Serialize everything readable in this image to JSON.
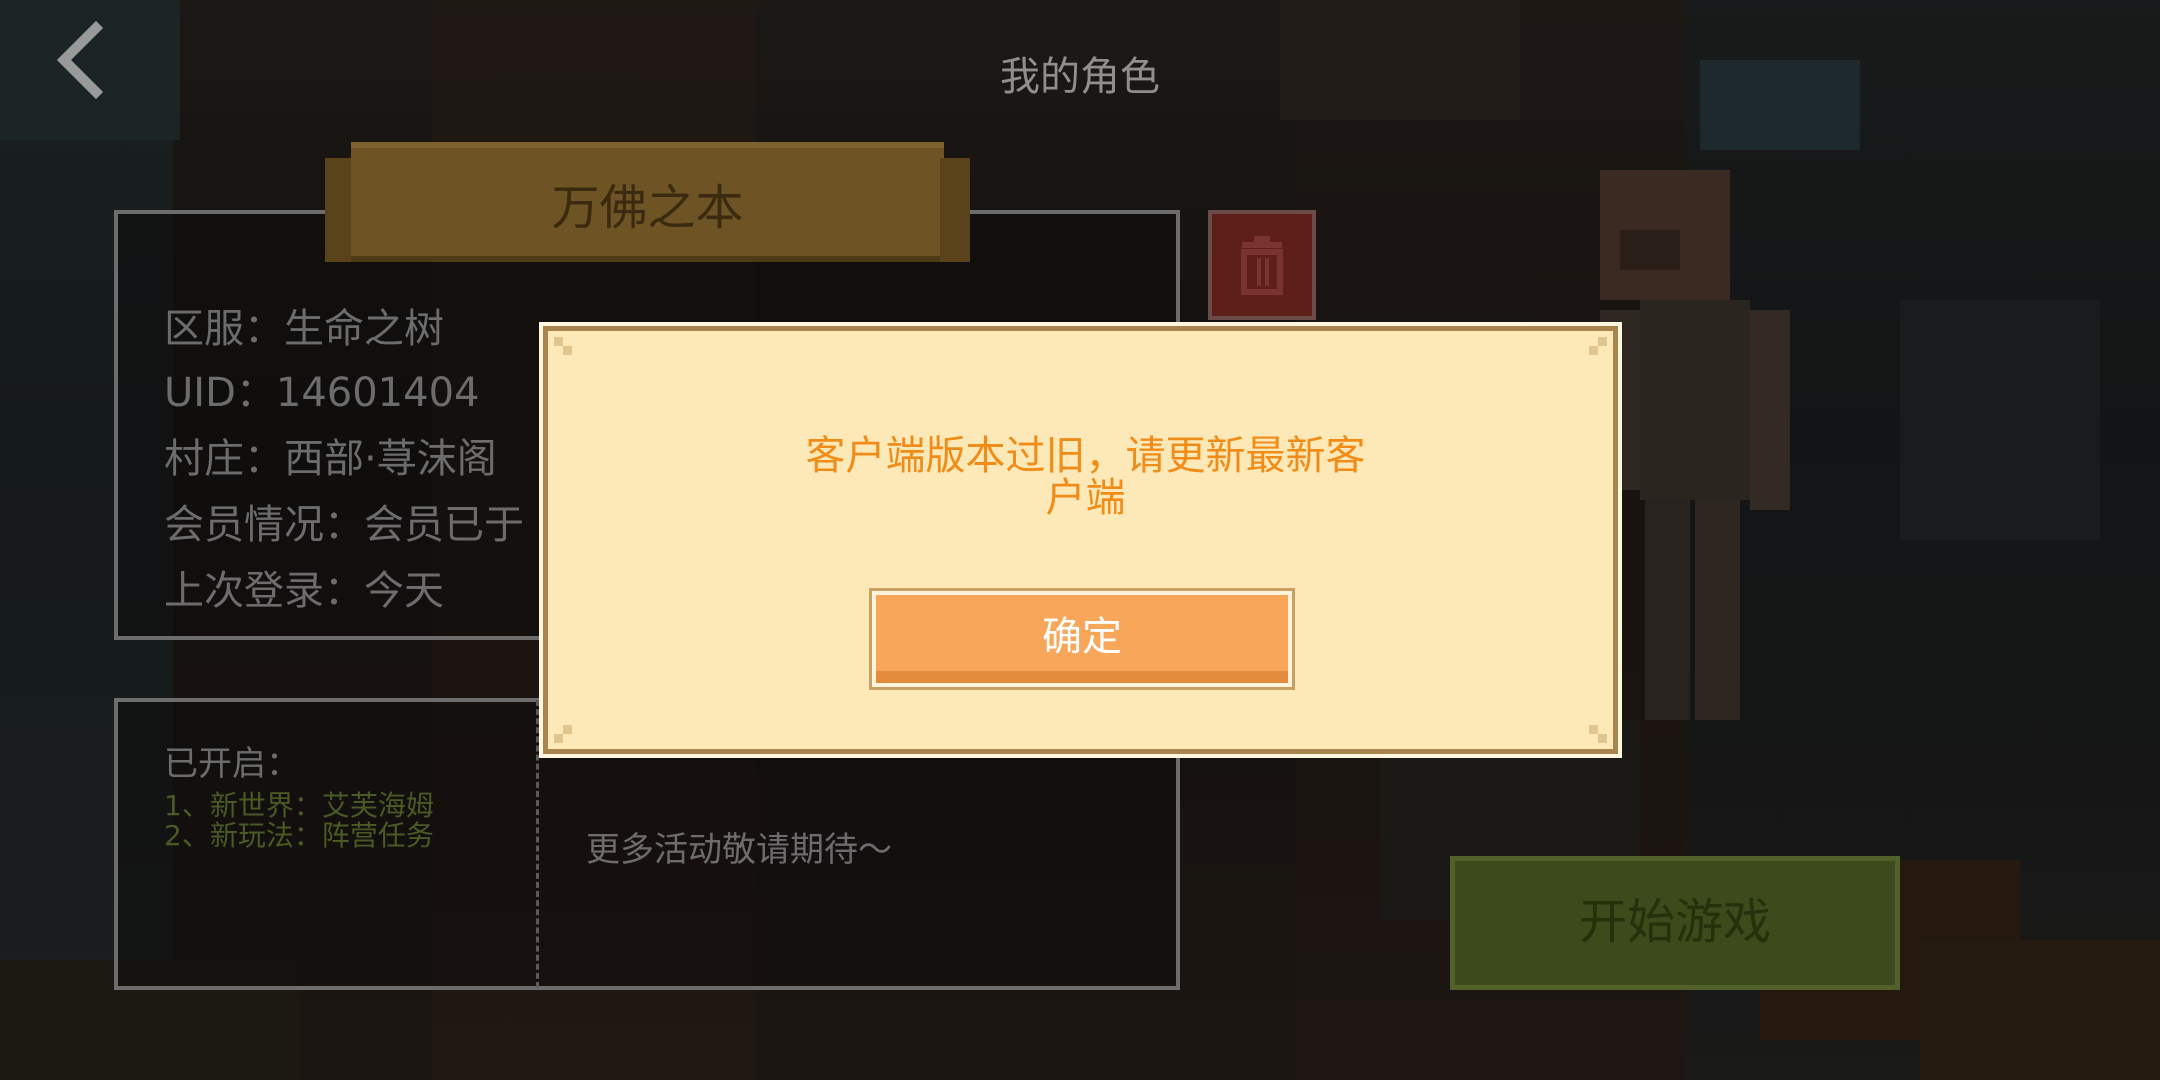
{
  "header": {
    "back_icon": "chevron-left-icon",
    "title": "我的角色"
  },
  "character": {
    "name": "万佛之本",
    "info": [
      "区服：生命之树",
      "UID：14601404",
      "村庄：西部·荨沫阁",
      "会员情况：会员已于",
      "上次登录：今天"
    ],
    "delete_icon": "trash-icon"
  },
  "events": {
    "opened_title": "已开启：",
    "opened_items": [
      "1、新世界：艾芙海姆",
      "2、新玩法：阵营任务"
    ],
    "more_text": "更多活动敬请期待～"
  },
  "start_button": {
    "label": "开始游戏",
    "color": "#3d4a1c"
  },
  "dialog": {
    "message_line1": "客户端版本过旧，请更新最新客",
    "message_line2": "户端",
    "confirm_label": "确定",
    "message_color": "#f08c17",
    "background_color": "#fde9b8",
    "button_color": "#f8a65a"
  }
}
